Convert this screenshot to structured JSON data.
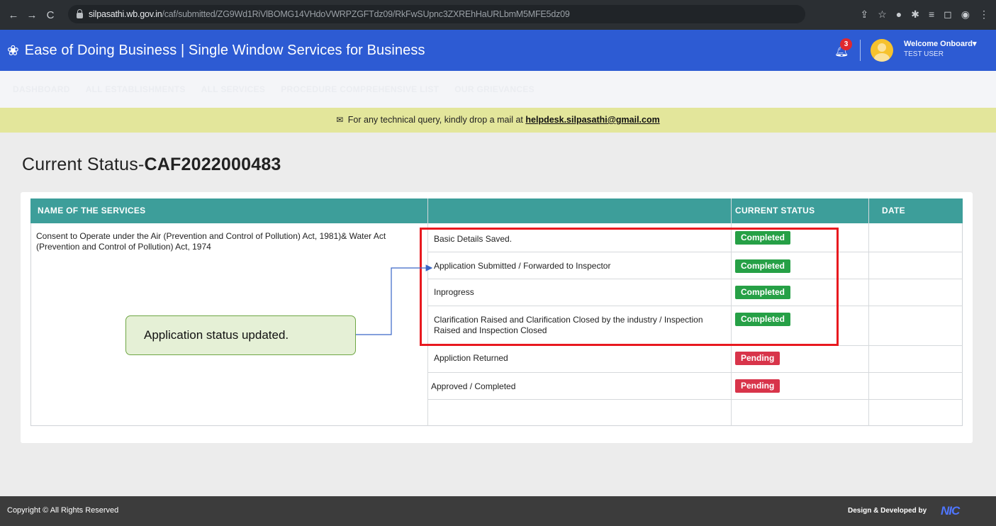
{
  "browser": {
    "url_host": "silpasathi.wb.gov.in",
    "url_path": "/caf/submitted/ZG9Wd1RiVlBOMG14VHdoVWRPZGFTdz09/RkFwSUpnc3ZXREhHaURLbmM5MFE5dz09"
  },
  "header": {
    "title": "Ease of Doing Business | Single Window Services for Business",
    "notification_count": "3",
    "welcome": "Welcome Onboard▾",
    "user": "TEST USER"
  },
  "nav": [
    "DASHBOARD",
    "ALL ESTABLISHMENTS",
    "ALL SERVICES",
    "PROCEDURE COMPREHENSIVE LIST",
    "OUR GRIEVANCES"
  ],
  "notice": {
    "text": "For any technical query, kindly drop a mail at",
    "email": "helpdesk.silpasathi@gmail.com"
  },
  "page": {
    "title_prefix": "Current Status-",
    "caf_number": "CAF2022000483"
  },
  "table": {
    "headers": [
      "NAME OF THE SERVICES",
      "",
      "CURRENT STATUS",
      "DATE"
    ],
    "service": "Consent to Operate under the Air (Prevention and Control of Pollution) Act, 1981)& Water Act (Prevention and Control of Pollution) Act, 1974",
    "steps": [
      {
        "text": "Basic Details Saved.",
        "status": "Completed"
      },
      {
        "text": "Application Submitted / Forwarded to Inspector",
        "status": "Completed"
      },
      {
        "text": "Inprogress",
        "status": "Completed"
      },
      {
        "text": "Clarification Raised and Clarification Closed by the industry / Inspection Raised and Inspection Closed",
        "status": "Completed"
      },
      {
        "text": "Appliction Returned",
        "status": "Pending"
      },
      {
        "text": "Approved / Completed",
        "status": "Pending"
      }
    ]
  },
  "callout": "Application status updated.",
  "footer": {
    "copyright": "Copyright © All Rights Reserved",
    "design": "Design & Developed by",
    "logo": "NIC"
  },
  "colors": {
    "header_blue": "#2d5bd3",
    "table_header": "#3d9e9a",
    "completed": "#26a046",
    "pending": "#d8344a",
    "highlight": "#e8191f"
  }
}
